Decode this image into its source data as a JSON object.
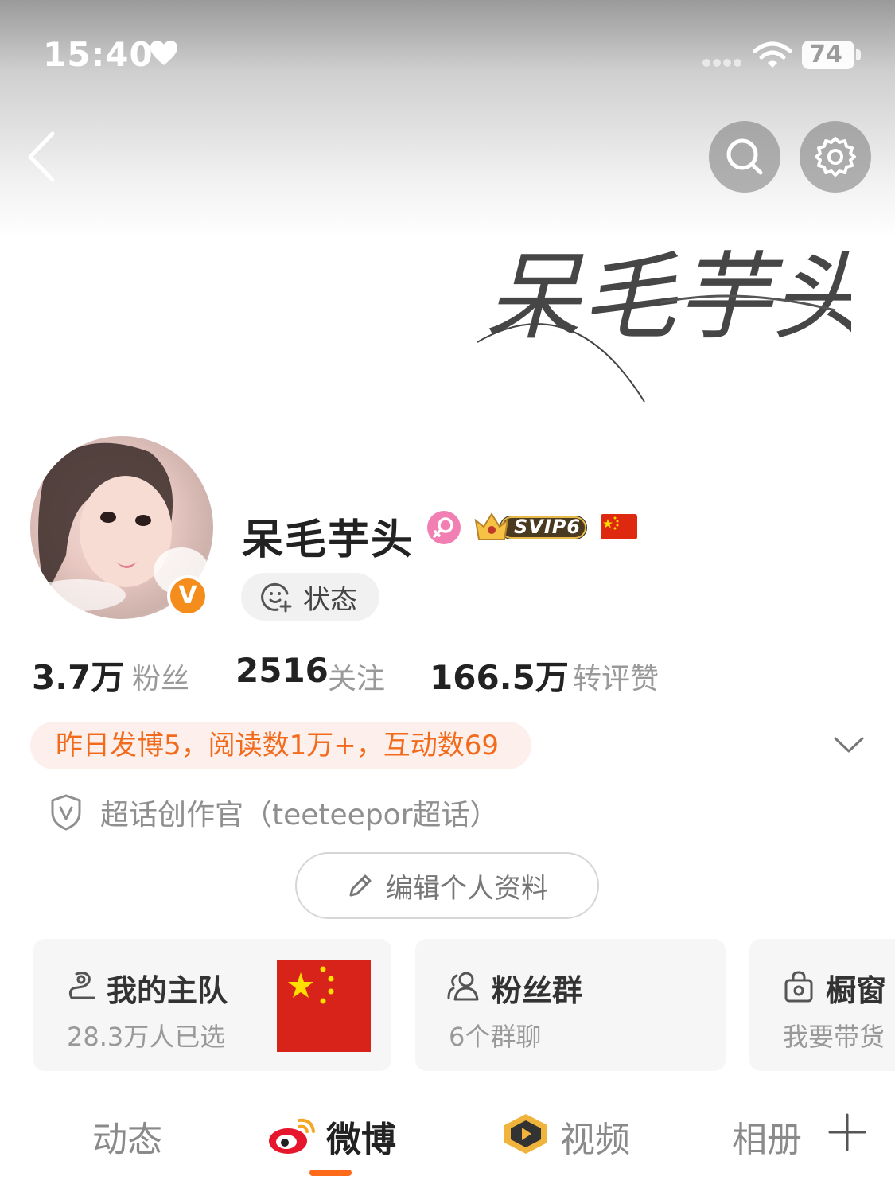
{
  "status_bar": {
    "time": "15:40",
    "battery": "74"
  },
  "profile": {
    "cover_title": "呆毛芋头",
    "name": "呆毛芋头",
    "vip_badge": "SVIP6",
    "status_label": "状态",
    "verified_badge": "V"
  },
  "stats": [
    {
      "value": "3.7万",
      "label": "粉丝"
    },
    {
      "value": "2516",
      "label": "关注"
    },
    {
      "value": "166.5万",
      "label": "转评赞"
    }
  ],
  "activity": "昨日发博5，阅读数1万+，互动数69",
  "creator_title": "超话创作官（teeteepor超话）",
  "edit_profile_label": "编辑个人资料",
  "cards": [
    {
      "title": "我的主队",
      "subtitle": "28.3万人已选"
    },
    {
      "title": "粉丝群",
      "subtitle": "6个群聊"
    },
    {
      "title": "橱窗",
      "subtitle": "我要带货"
    }
  ],
  "tabs": [
    {
      "label": "动态",
      "active": false
    },
    {
      "label": "微博",
      "active": true
    },
    {
      "label": "视频",
      "active": false
    },
    {
      "label": "相册",
      "active": false
    }
  ],
  "colors": {
    "accent": "#ff6a1a",
    "activity_text": "#f26b1d",
    "activity_bg": "#fdf0ec",
    "verified": "#f58d1c"
  }
}
